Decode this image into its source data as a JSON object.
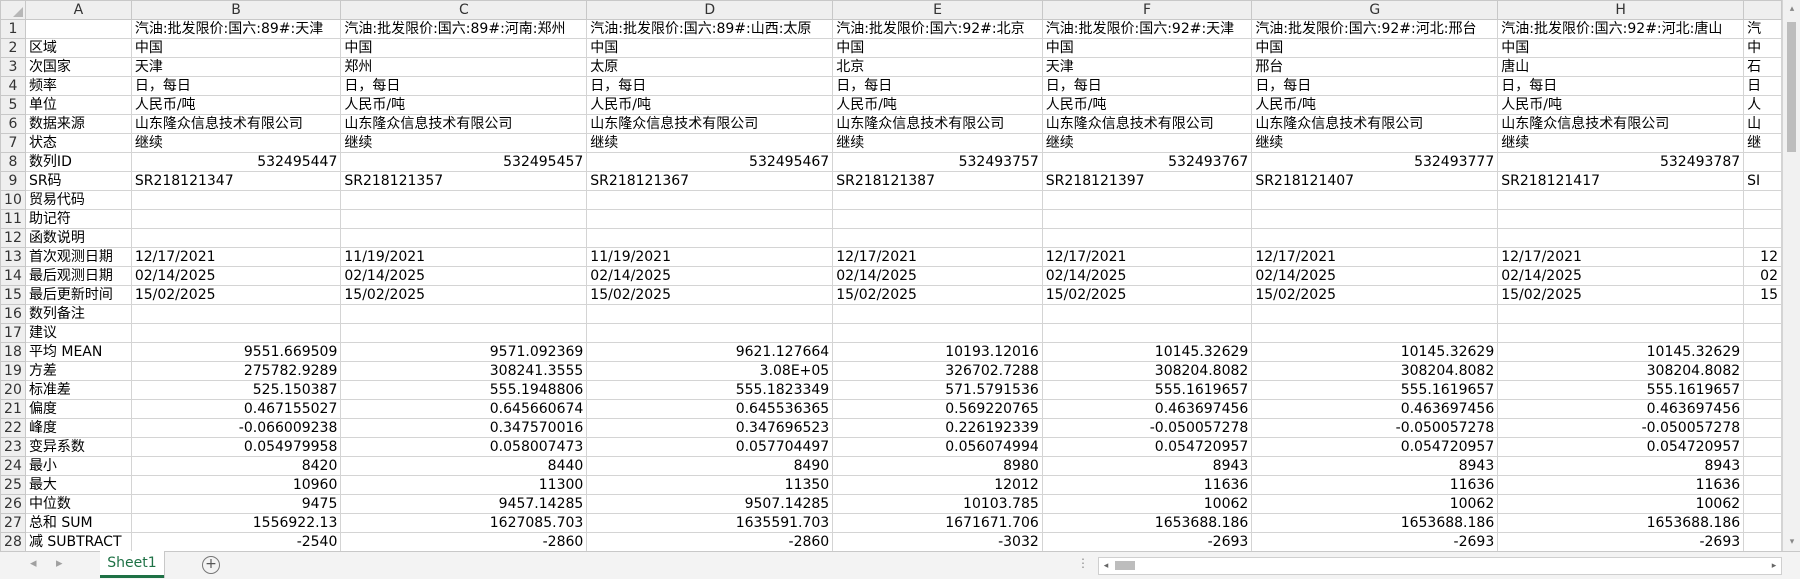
{
  "columns": [
    "A",
    "B",
    "C",
    "D",
    "E",
    "F",
    "G",
    "H",
    ""
  ],
  "rows": [
    [
      "",
      "汽油:批发限价:国六:89#:天津",
      "汽油:批发限价:国六:89#:河南:郑州",
      "汽油:批发限价:国六:89#:山西:太原",
      "汽油:批发限价:国六:92#:北京",
      "汽油:批发限价:国六:92#:天津",
      "汽油:批发限价:国六:92#:河北:邢台",
      "汽油:批发限价:国六:92#:河北:唐山",
      "汽"
    ],
    [
      "区域",
      "中国",
      "中国",
      "中国",
      "中国",
      "中国",
      "中国",
      "中国",
      "中"
    ],
    [
      "次国家",
      "天津",
      "郑州",
      "太原",
      "北京",
      "天津",
      "邢台",
      "唐山",
      "石"
    ],
    [
      "频率",
      "日，每日",
      "日，每日",
      "日，每日",
      "日，每日",
      "日，每日",
      "日，每日",
      "日，每日",
      "日"
    ],
    [
      "单位",
      "人民币/吨",
      "人民币/吨",
      "人民币/吨",
      "人民币/吨",
      "人民币/吨",
      "人民币/吨",
      "人民币/吨",
      "人"
    ],
    [
      "数据来源",
      "山东隆众信息技术有限公司",
      "山东隆众信息技术有限公司",
      "山东隆众信息技术有限公司",
      "山东隆众信息技术有限公司",
      "山东隆众信息技术有限公司",
      "山东隆众信息技术有限公司",
      "山东隆众信息技术有限公司",
      "山"
    ],
    [
      "状态",
      "继续",
      "继续",
      "继续",
      "继续",
      "继续",
      "继续",
      "继续",
      "继"
    ],
    [
      "数列ID",
      "532495447",
      "532495457",
      "532495467",
      "532493757",
      "532493767",
      "532493777",
      "532493787",
      ""
    ],
    [
      "SR码",
      "SR218121347",
      "SR218121357",
      "SR218121367",
      "SR218121387",
      "SR218121397",
      "SR218121407",
      "SR218121417",
      "SI"
    ],
    [
      "贸易代码",
      "",
      "",
      "",
      "",
      "",
      "",
      "",
      ""
    ],
    [
      "助记符",
      "",
      "",
      "",
      "",
      "",
      "",
      "",
      ""
    ],
    [
      "函数说明",
      "",
      "",
      "",
      "",
      "",
      "",
      "",
      ""
    ],
    [
      "首次观测日期",
      "12/17/2021",
      "11/19/2021",
      "11/19/2021",
      "12/17/2021",
      "12/17/2021",
      "12/17/2021",
      "12/17/2021",
      "12"
    ],
    [
      "最后观测日期",
      "02/14/2025",
      "02/14/2025",
      "02/14/2025",
      "02/14/2025",
      "02/14/2025",
      "02/14/2025",
      "02/14/2025",
      "02"
    ],
    [
      "最后更新时间",
      "15/02/2025",
      "15/02/2025",
      "15/02/2025",
      "15/02/2025",
      "15/02/2025",
      "15/02/2025",
      "15/02/2025",
      "15"
    ],
    [
      "数列备注",
      "",
      "",
      "",
      "",
      "",
      "",
      "",
      ""
    ],
    [
      "建议",
      "",
      "",
      "",
      "",
      "",
      "",
      "",
      ""
    ],
    [
      "平均 MEAN",
      "9551.669509",
      "9571.092369",
      "9621.127664",
      "10193.12016",
      "10145.32629",
      "10145.32629",
      "10145.32629",
      ""
    ],
    [
      "方差",
      "275782.9289",
      "308241.3555",
      "3.08E+05",
      "326702.7288",
      "308204.8082",
      "308204.8082",
      "308204.8082",
      ""
    ],
    [
      "标准差",
      "525.150387",
      "555.1948806",
      "555.1823349",
      "571.5791536",
      "555.1619657",
      "555.1619657",
      "555.1619657",
      ""
    ],
    [
      "偏度",
      "0.467155027",
      "0.645660674",
      "0.645536365",
      "0.569220765",
      "0.463697456",
      "0.463697456",
      "0.463697456",
      ""
    ],
    [
      "峰度",
      "-0.066009238",
      "0.347570016",
      "0.347696523",
      "0.226192339",
      "-0.050057278",
      "-0.050057278",
      "-0.050057278",
      ""
    ],
    [
      "变异系数",
      "0.054979958",
      "0.058007473",
      "0.057704497",
      "0.056074994",
      "0.054720957",
      "0.054720957",
      "0.054720957",
      ""
    ],
    [
      "最小",
      "8420",
      "8440",
      "8490",
      "8980",
      "8943",
      "8943",
      "8943",
      ""
    ],
    [
      "最大",
      "10960",
      "11300",
      "11350",
      "12012",
      "11636",
      "11636",
      "11636",
      ""
    ],
    [
      "中位数",
      "9475",
      "9457.14285",
      "9507.14285",
      "10103.785",
      "10062",
      "10062",
      "10062",
      ""
    ],
    [
      "总和 SUM",
      "1556922.13",
      "1627085.703",
      "1635591.703",
      "1671671.706",
      "1653688.186",
      "1653688.186",
      "1653688.186",
      ""
    ],
    [
      "减 SUBTRACT",
      "-2540",
      "-2860",
      "-2860",
      "-3032",
      "-2693",
      "-2693",
      "-2693",
      ""
    ]
  ],
  "sheet_tab": "Sheet1",
  "add_sheet": "⊕",
  "nav_prev": "◂",
  "nav_next": "▸",
  "hdots": "⋮",
  "scroll_up": "▴",
  "scroll_down": "▾",
  "scroll_left": "◂",
  "scroll_right": "▸"
}
